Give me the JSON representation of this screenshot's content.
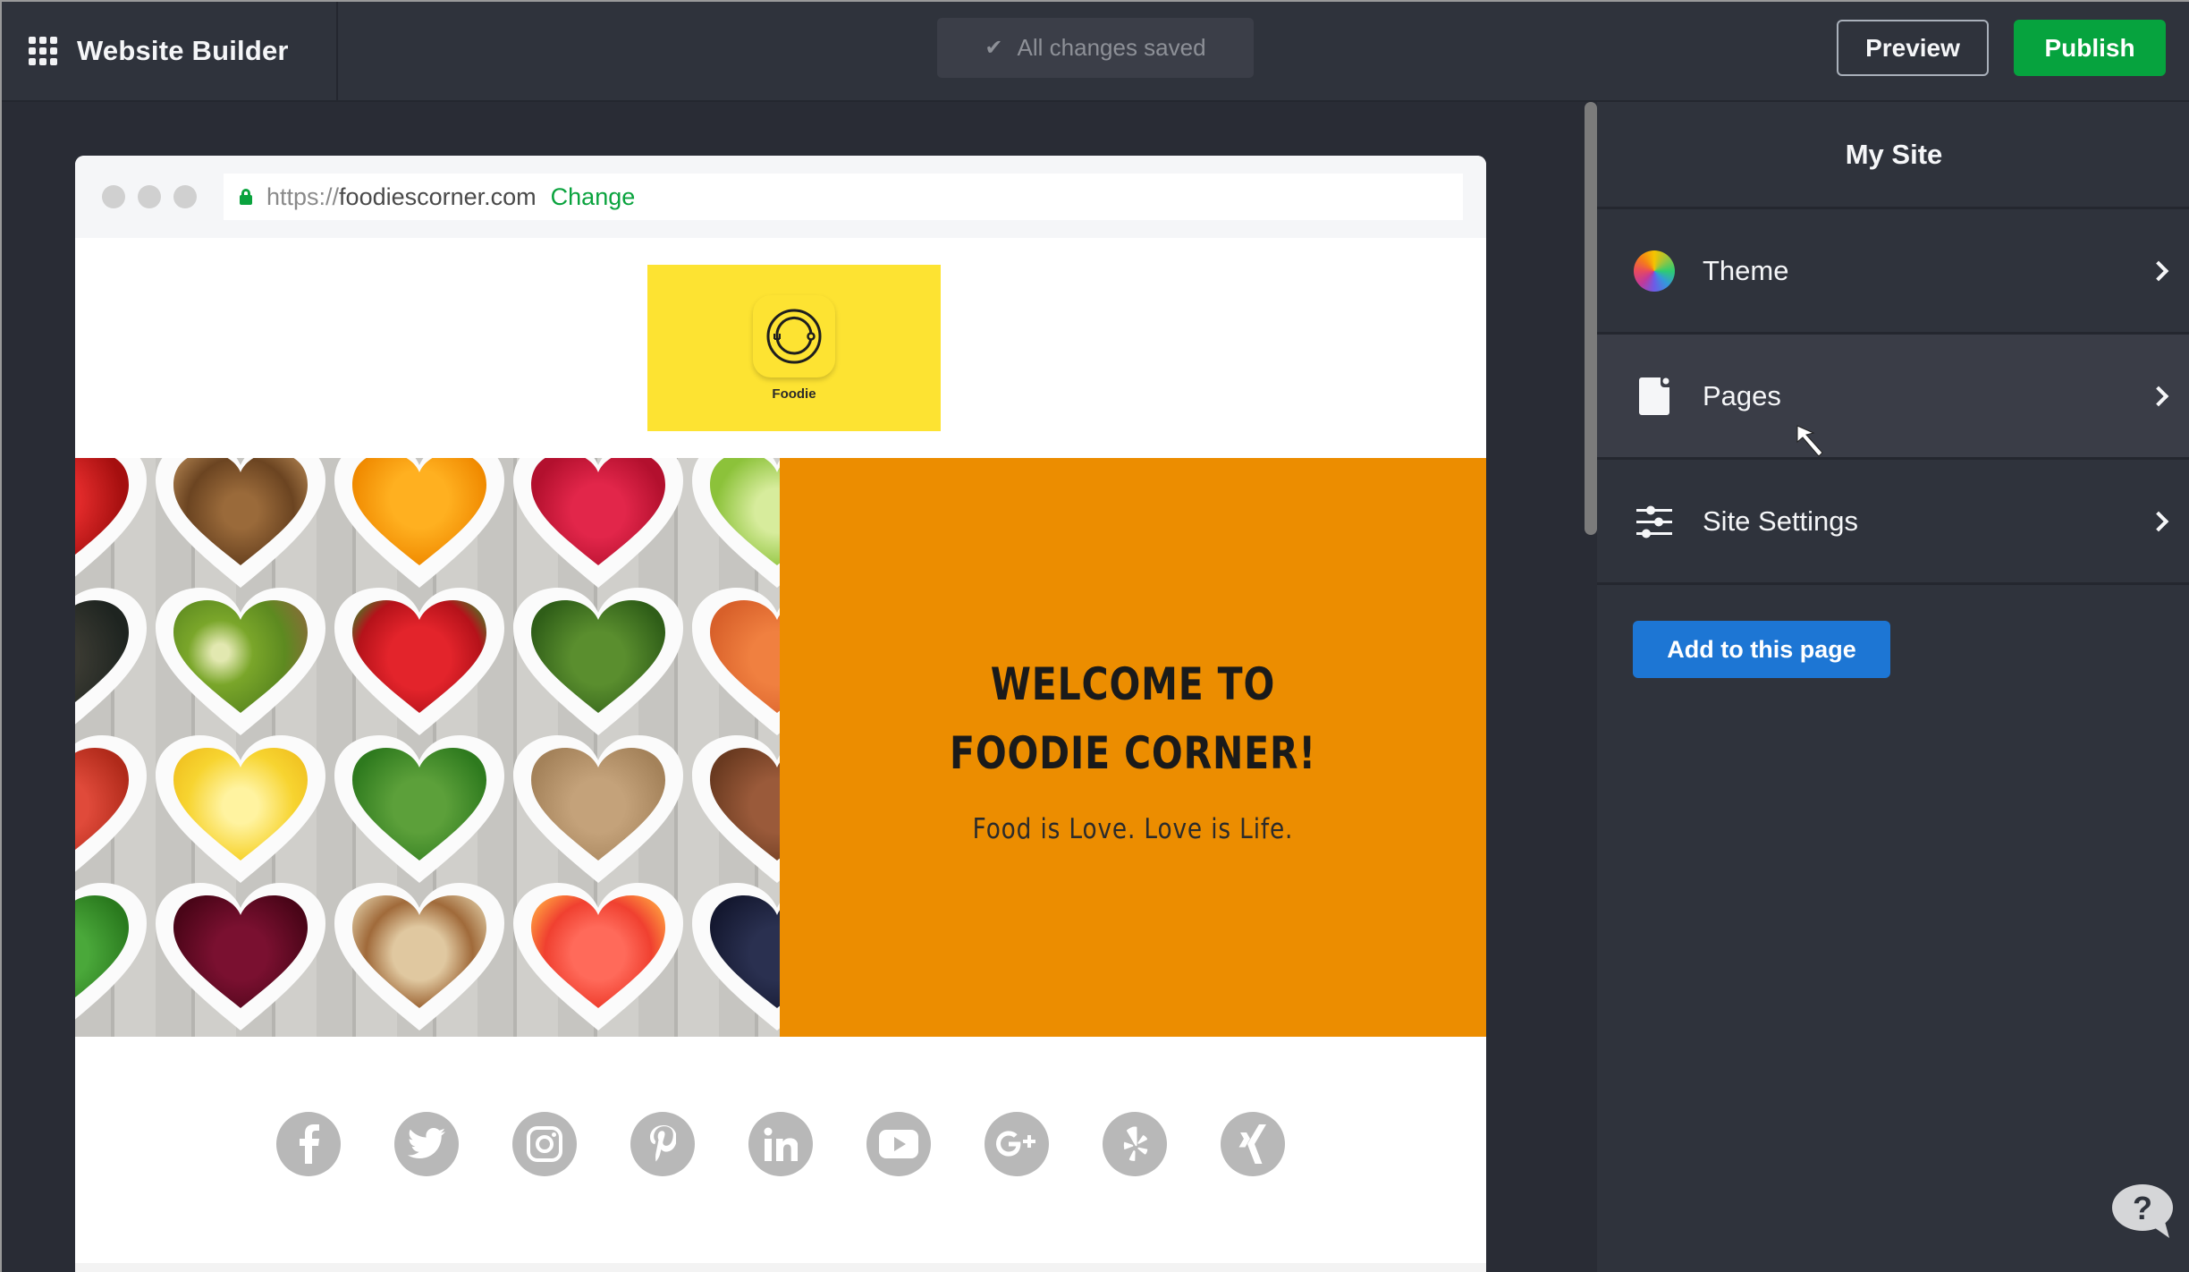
{
  "header": {
    "app_title": "Website Builder",
    "apps_icon": "grid-icon",
    "save_status": "All changes saved",
    "save_status_icon": "check-icon",
    "preview_label": "Preview",
    "publish_label": "Publish"
  },
  "browser": {
    "url_protocol": "https://",
    "url_host": "foodiescorner.com",
    "change_label": "Change",
    "lock_icon": "lock-icon"
  },
  "site": {
    "logo_text": "Foodie",
    "hero_title_line1": "WELCOME TO",
    "hero_title_line2": "FOODIE CORNER!",
    "hero_subtitle": "Food is Love. Love is Life.",
    "hero_image": "healthy-food-heart-bowls",
    "social": [
      {
        "name": "facebook",
        "glyph": "f"
      },
      {
        "name": "twitter",
        "glyph": "t"
      },
      {
        "name": "instagram",
        "glyph": "ig"
      },
      {
        "name": "pinterest",
        "glyph": "p"
      },
      {
        "name": "linkedin",
        "glyph": "in"
      },
      {
        "name": "youtube",
        "glyph": "yt"
      },
      {
        "name": "google-plus",
        "glyph": "G+"
      },
      {
        "name": "yelp",
        "glyph": "y"
      },
      {
        "name": "xing",
        "glyph": "x"
      }
    ]
  },
  "panel": {
    "title": "My Site",
    "items": [
      {
        "label": "Theme",
        "icon": "color-wheel-icon"
      },
      {
        "label": "Pages",
        "icon": "page-icon"
      },
      {
        "label": "Site Settings",
        "icon": "sliders-icon"
      }
    ],
    "add_button": "Add to this page",
    "help_icon": "help-chat-icon"
  },
  "colors": {
    "publish": "#06a33e",
    "primary": "#1d76d4",
    "hero_bg": "#ec8d00",
    "logo_bg": "#fde332",
    "link_green": "#0aa33e"
  }
}
